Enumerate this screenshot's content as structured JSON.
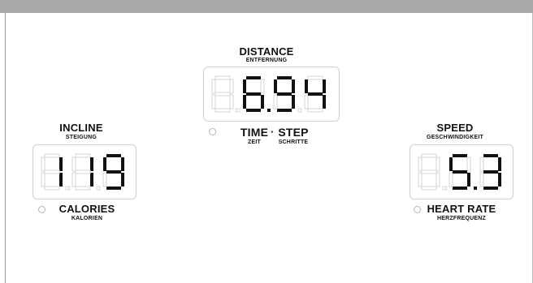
{
  "distance": {
    "label": "DISTANCE",
    "sublabel": "ENTFERNUNG",
    "value": "6.94"
  },
  "incline": {
    "label": "INCLINE",
    "sublabel": "STEIGUNG",
    "value": "119"
  },
  "speed": {
    "label": "SPEED",
    "sublabel": "GESCHWINDIGKEIT",
    "value": "5.3"
  },
  "time": {
    "label": "TIME",
    "sublabel": "ZEIT"
  },
  "step": {
    "label": "STEP",
    "sublabel": "SCHRITTE"
  },
  "separator": "·",
  "calories": {
    "label": "CALORIES",
    "sublabel": "KALORIEN"
  },
  "heart_rate": {
    "label": "HEART RATE",
    "sublabel": "HERZFREQUENZ"
  },
  "colors": {
    "lit": "#111111",
    "unlit": "#d6d6d6",
    "topbar": "#a9a9a9"
  }
}
